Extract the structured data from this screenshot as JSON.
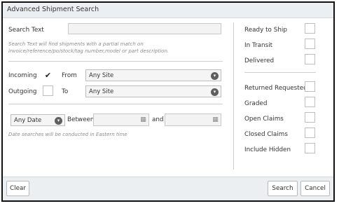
{
  "window": {
    "title": "Advanced Shipment Search"
  },
  "search": {
    "label": "Search Text",
    "value": "",
    "help": "Search Text will find shipments with a partial match on invoice/reference/po/stock/tag number,model or part description."
  },
  "direction": {
    "incoming_label": "Incoming",
    "incoming_checked": true,
    "outgoing_label": "Outgoing",
    "outgoing_checked": false,
    "from_label": "From",
    "from_value": "Any Site",
    "to_label": "To",
    "to_value": "Any Site"
  },
  "dates": {
    "range_value": "Any Date",
    "between_label": "Between",
    "and_label": "and",
    "start_value": "",
    "end_value": "",
    "note": "Date searches will be conducted in Eastern time"
  },
  "status_filters": [
    {
      "label": "Ready to Ship",
      "checked": false
    },
    {
      "label": "In Transit",
      "checked": false
    },
    {
      "label": "Delivered",
      "checked": false
    }
  ],
  "other_filters": [
    {
      "label": "Returned Requested",
      "checked": false
    },
    {
      "label": "Graded",
      "checked": false
    },
    {
      "label": "Open Claims",
      "checked": false
    },
    {
      "label": "Closed Claims",
      "checked": false
    },
    {
      "label": "Include Hidden",
      "checked": false
    }
  ],
  "footer": {
    "clear_label": "Clear",
    "search_label": "Search",
    "cancel_label": "Cancel"
  },
  "icons": {
    "checkmark": "check-icon",
    "dropdown": "chevron-down-icon",
    "calendar": "calendar-icon"
  }
}
